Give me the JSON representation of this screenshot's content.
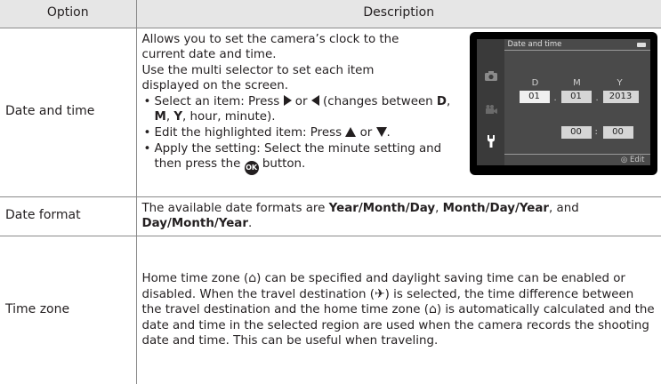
{
  "header": {
    "option": "Option",
    "description": "Description"
  },
  "rows": [
    {
      "option": "Date and time",
      "intro": [
        "Allows you to set the camera’s clock to the",
        "current date and time.",
        "Use the multi selector to set each item",
        "displayed on the screen."
      ],
      "b1_pre": "Select an item: Press ",
      "b1_or": " or ",
      "b1_mid": " (changes between ",
      "b1_D": "D",
      "b1_comma1": ", ",
      "b1_M": "M",
      "b1_comma2": ", ",
      "b1_Y": "Y",
      "b1_post": ", hour, minute).",
      "b2_pre": "Edit the highlighted item: Press ",
      "b2_or": " or ",
      "b2_post": ".",
      "b3_pre": "Apply the setting: Select the minute setting and then press the ",
      "b3_post": " button."
    },
    {
      "option": "Date format",
      "pre": "The available date formats are ",
      "f1": "Year/Month/Day",
      "sep1": ", ",
      "f2": "Month/Day/Year",
      "sep2": ", and ",
      "f3": "Day/Month/Year",
      "post": "."
    },
    {
      "option": "Time zone",
      "p1": "Home time zone (",
      "p2": ") can be specified and daylight saving time can be enabled or disabled. When the travel destination (",
      "p3": ") is selected, the time difference between the travel destination and the home time zone (",
      "p4": ") is automatically calculated and the date and time in the selected region are used when the camera records the shooting date and time. This can be useful when traveling."
    }
  ],
  "ok_label": "OK",
  "camera": {
    "title": "Date and time",
    "labels": [
      "D",
      "M",
      "Y"
    ],
    "date": [
      "01",
      "01",
      "2013"
    ],
    "time": [
      "00",
      "00"
    ],
    "edit": "Edit"
  },
  "colors": {
    "header_bg": "#e6e6e6",
    "border": "#8a8a8a",
    "text": "#231f20",
    "screen_bg": "#4a4a4a"
  }
}
